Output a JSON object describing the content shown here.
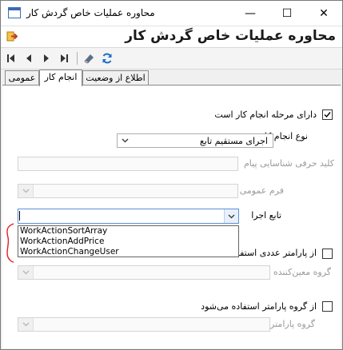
{
  "window": {
    "title": "محاوره عملیات خاص گردش کار",
    "header_title": "محاوره عملیات خاص گردش کار"
  },
  "title_buttons": {
    "minimize": "—",
    "maximize": "☐",
    "close": "✕"
  },
  "toolbar": {
    "icons": [
      "first-record-icon",
      "previous-record-icon",
      "next-record-icon",
      "last-record-icon",
      "clear-icon",
      "refresh-icon"
    ]
  },
  "tabs": [
    {
      "label": "عمومی",
      "active": false
    },
    {
      "label": "انجام کار",
      "active": true
    },
    {
      "label": "اطلاع از وضعیت",
      "active": false
    }
  ],
  "form": {
    "has_work_stage": {
      "label": "دارای مرحله انجام کار است",
      "checked": true
    },
    "work_type": {
      "label": "نوع انجام کار",
      "value": "اجرای مستقیم تابع"
    },
    "message_key": {
      "label": "کلید حرفی شناسایی پیام",
      "value": ""
    },
    "general_form": {
      "label": "فرم عمومی",
      "value": ""
    },
    "execute_function": {
      "label": "تابع اجرا",
      "value": ""
    },
    "numeric_param": {
      "label": "از پارامتر عددی استفاده",
      "checked": false
    },
    "group_determiner": {
      "label": "گروه معین‌کننده",
      "value": ""
    },
    "param_group_used": {
      "label": "از گروه پارامتر استفاده می‌شود",
      "checked": false
    },
    "param_group": {
      "label": "گروه پارامتر",
      "value": ""
    }
  },
  "dropdown": {
    "options": [
      "WorkActionSortArray",
      "WorkActionAddPrice",
      "WorkActionChangeUser"
    ]
  },
  "colors": {
    "annotation": "#e02020",
    "active_border": "#5b8fd6"
  }
}
